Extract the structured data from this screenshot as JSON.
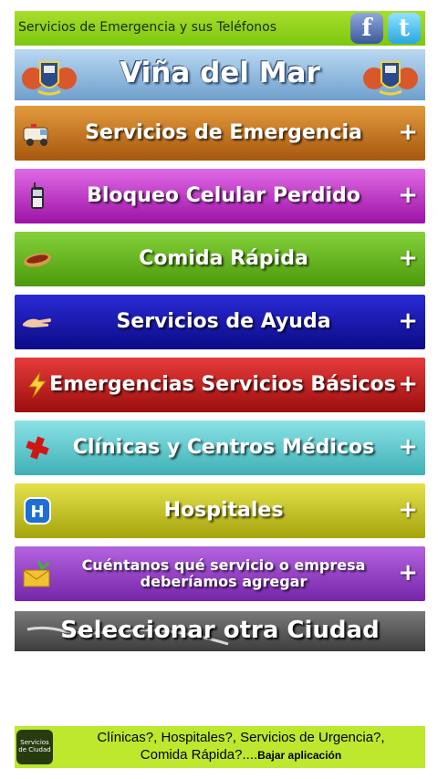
{
  "header": {
    "title": "Servicios de Emergencia y sus Teléfonos",
    "facebook": "f",
    "twitter": "t"
  },
  "city": {
    "title": "Viña del Mar"
  },
  "categories": [
    {
      "label": "Servicios de Emergencia",
      "color_top": "#e39a3c",
      "color_bottom": "#a7570f",
      "icon": "ambulance-icon"
    },
    {
      "label": "Bloqueo Celular Perdido",
      "color_top": "#e06be6",
      "color_bottom": "#9c12a6",
      "icon": "mobile-phone-icon"
    },
    {
      "label": "Comida Rápida",
      "color_top": "#84d13a",
      "color_bottom": "#4c9a0c",
      "icon": "hot-dog-icon"
    },
    {
      "label": "Servicios de Ayuda",
      "color_top": "#2a2ad6",
      "color_bottom": "#0b0b86",
      "icon": "helping-hand-icon"
    },
    {
      "label": "Emergencias Servicios Básicos",
      "color_top": "#e73b3b",
      "color_bottom": "#9b0e0e",
      "icon": "lightning-icon"
    },
    {
      "label": "Clínicas y Centros Médicos",
      "color_top": "#8ae2e6",
      "color_bottom": "#3fb0b5",
      "icon": "medical-cross-icon"
    },
    {
      "label": "Hospitales",
      "color_top": "#e4e24a",
      "color_bottom": "#a6a40d",
      "icon": "hospital-icon"
    },
    {
      "label": "Cuéntanos qué servicio o empresa deberíamos agregar",
      "color_top": "#b463e0",
      "color_bottom": "#7525a8",
      "icon": "mail-icon"
    }
  ],
  "plus_symbol": "+",
  "select_city": {
    "label": "Seleccionar otra Ciudad"
  },
  "footer": {
    "logo_text": "Servicios de Ciudad",
    "line1": "Clínicas?, Hospitales?, Servicios de Urgencia?,",
    "line2": "Comida Rápida?....",
    "link": "Bajar aplicación"
  }
}
